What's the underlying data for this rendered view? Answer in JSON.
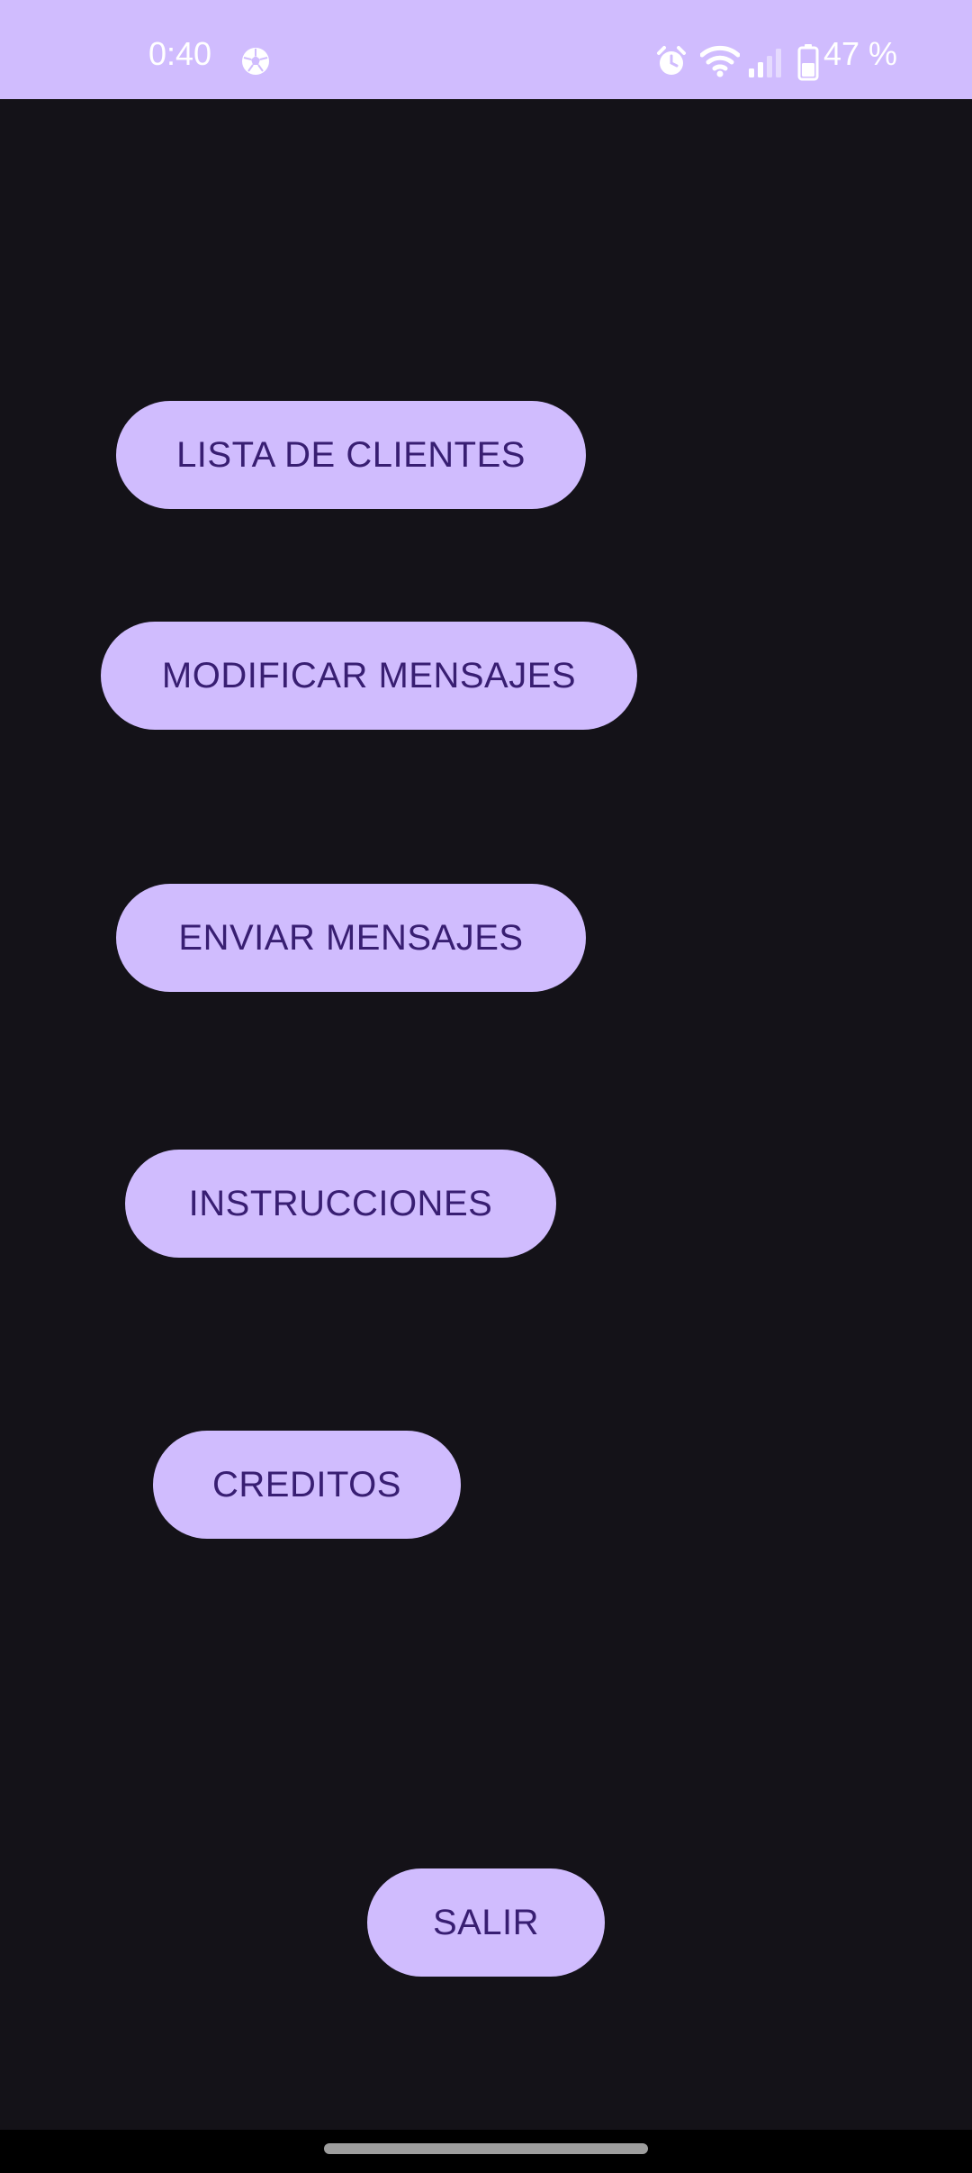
{
  "status_bar": {
    "time": "0:40",
    "battery_text": "47 %",
    "background": "#d0bcfe",
    "icons": [
      "soccer-ball-icon",
      "alarm-icon",
      "wifi-icon",
      "cell-signal-icon",
      "battery-icon"
    ]
  },
  "menu": {
    "lista_clientes": "LISTA DE CLIENTES",
    "modificar_mensajes": "MODIFICAR MENSAJES",
    "enviar_mensajes": "ENVIAR MENSAJES",
    "instrucciones": "INSTRUCCIONES",
    "creditos": "CREDITOS",
    "salir": "SALIR"
  },
  "colors": {
    "page_background": "#141218",
    "button_background": "#d0bcfe",
    "button_text": "#381e72"
  }
}
